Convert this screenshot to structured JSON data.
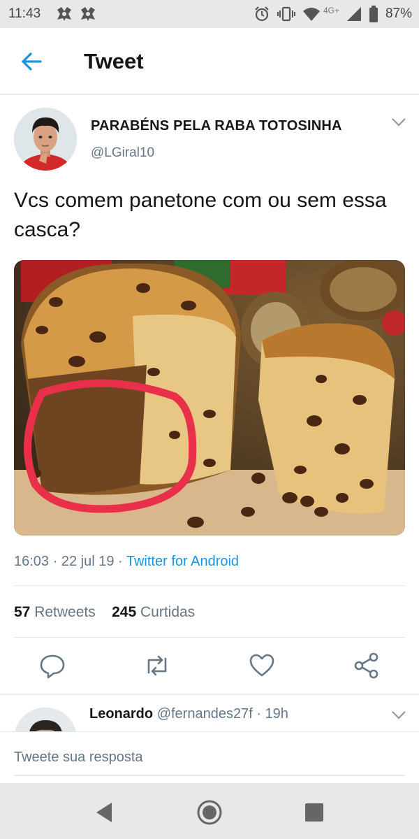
{
  "status_bar": {
    "time": "11:43",
    "network": "4G+",
    "battery": "87%"
  },
  "app_bar": {
    "title": "Tweet"
  },
  "tweet": {
    "author_name": "PARABÉNS PELA RABA TOTOSINHA",
    "author_handle": "@LGiral10",
    "text": "Vcs comem panetone com ou sem essa casca?",
    "timestamp": "16:03 · 22 jul 19 · ",
    "source": "Twitter for Android",
    "retweets_count": "57",
    "retweets_label": "Retweets",
    "likes_count": "245",
    "likes_label": "Curtidas"
  },
  "reply_preview": {
    "name": "Leonardo",
    "handle_time": "@fernandes27f · 19h"
  },
  "compose": {
    "placeholder": "Tweete sua resposta"
  },
  "colors": {
    "accent": "#1b95e0",
    "highlight_circle": "#e8304a",
    "text": "#14171a",
    "muted": "#657786"
  },
  "icons": [
    "back-arrow-icon",
    "chevron-down-icon",
    "reply-icon",
    "retweet-icon",
    "like-icon",
    "share-icon",
    "nav-back-icon",
    "nav-home-icon",
    "nav-recents-icon"
  ]
}
